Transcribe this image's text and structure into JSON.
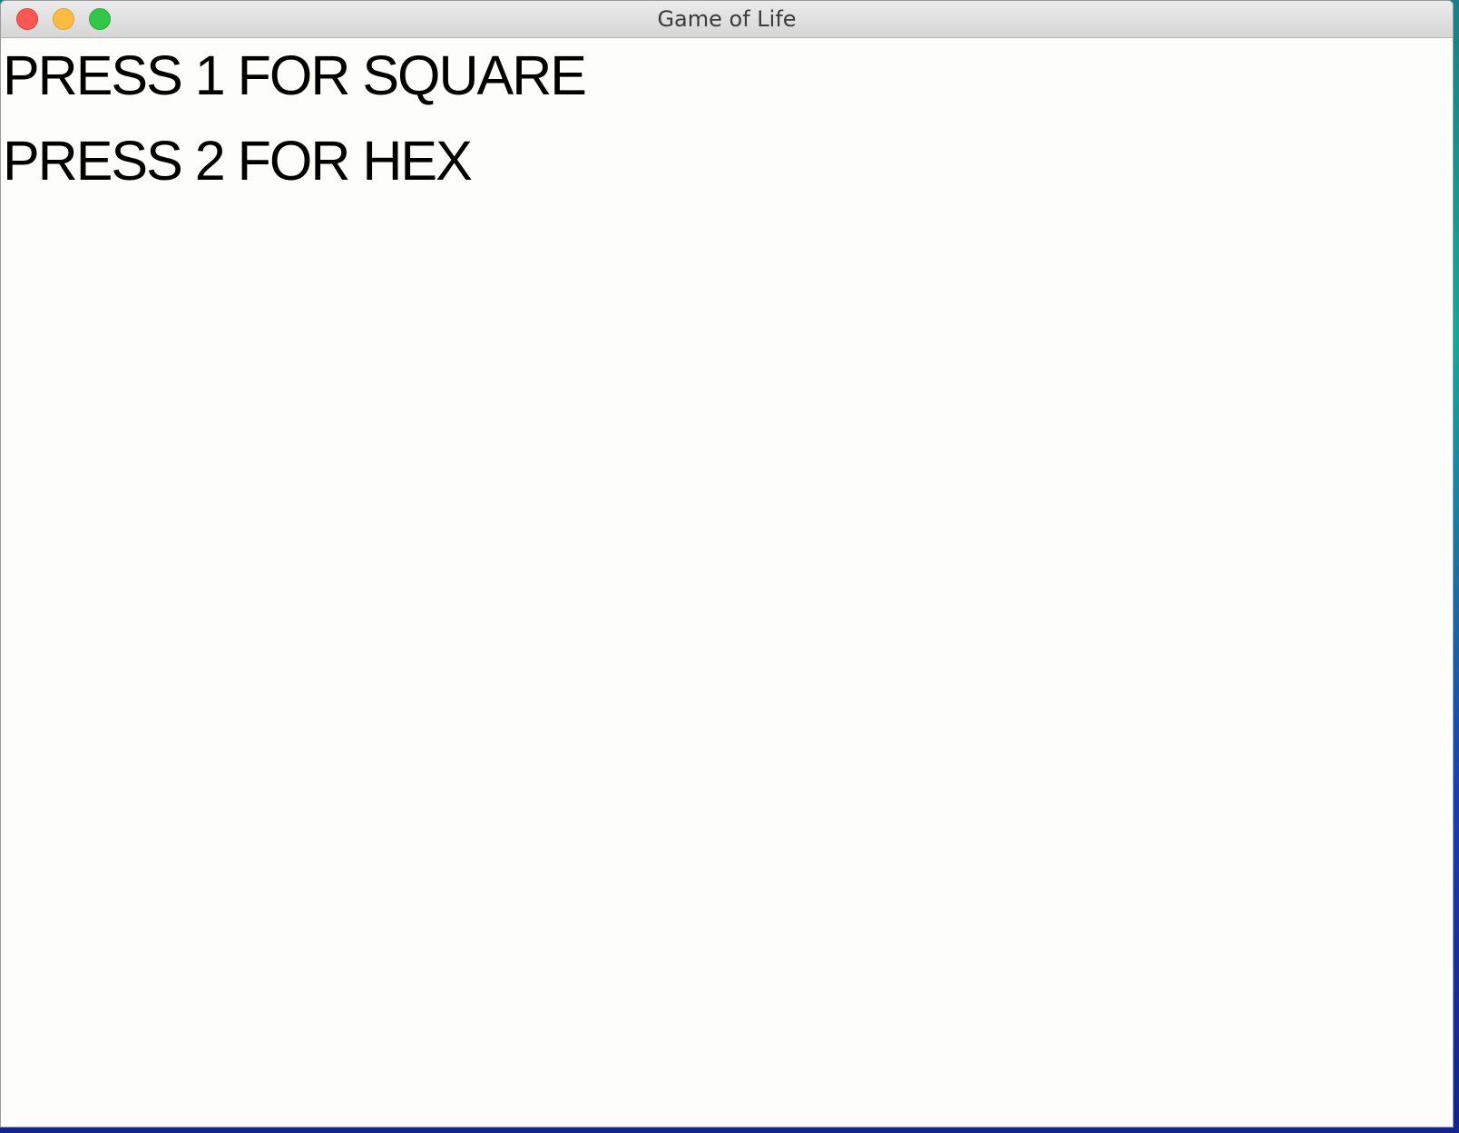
{
  "window": {
    "title": "Game of Life",
    "controls": {
      "close_icon": "close-icon",
      "minimize_icon": "minimize-icon",
      "zoom_icon": "zoom-icon"
    },
    "colors": {
      "close": "#fc5753",
      "minimize": "#fdbc40",
      "zoom": "#33c748",
      "background": "#fdfdfb",
      "text": "#000000"
    }
  },
  "content": {
    "lines": [
      "PRESS 1 FOR SQUARE",
      "PRESS 2 FOR HEX"
    ]
  }
}
